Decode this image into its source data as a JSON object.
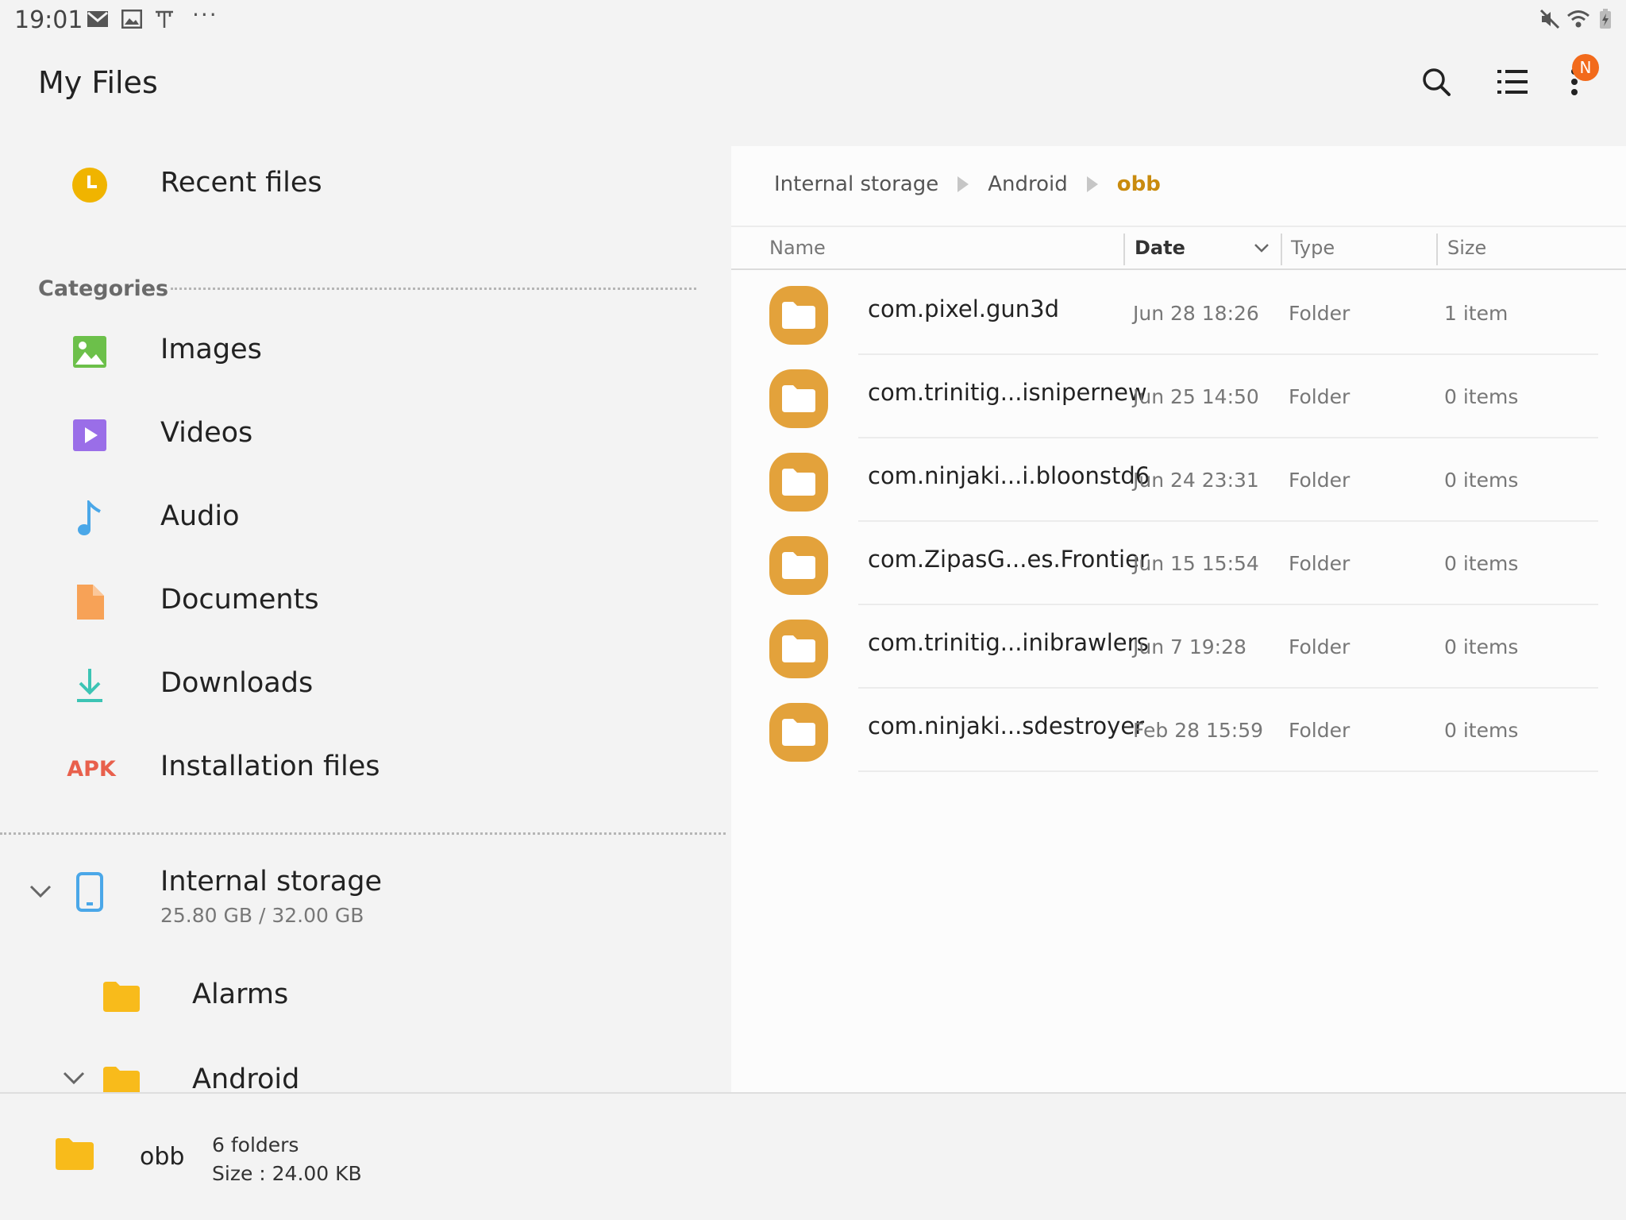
{
  "status_bar": {
    "time": "19:01",
    "left_icons": [
      "gmail-icon",
      "gallery-icon",
      "t-app-icon"
    ],
    "more": "···",
    "right_icons": [
      "mute-icon",
      "wifi-icon",
      "battery-charging-icon"
    ]
  },
  "app_bar": {
    "title": "My Files",
    "badge": "N",
    "actions": [
      "search-icon",
      "list-view-icon",
      "more-vert-icon"
    ]
  },
  "sidebar": {
    "recent": "Recent files",
    "categories_header": "Categories",
    "categories": [
      {
        "label": "Images",
        "icon": "image-icon",
        "color": "#6cc04a"
      },
      {
        "label": "Videos",
        "icon": "video-icon",
        "color": "#9a6ee8"
      },
      {
        "label": "Audio",
        "icon": "audio-note-icon",
        "color": "#4aa7e8"
      },
      {
        "label": "Documents",
        "icon": "document-icon",
        "color": "#f7a257"
      },
      {
        "label": "Downloads",
        "icon": "download-icon",
        "color": "#3cc4b4"
      },
      {
        "label": "Installation files",
        "icon": "apk-icon",
        "icon_text": "APK",
        "color": "#e8604c"
      }
    ],
    "storage": {
      "label": "Internal storage",
      "usage": "25.80 GB / 32.00 GB"
    },
    "folders": [
      {
        "label": "Alarms"
      },
      {
        "label": "Android"
      }
    ]
  },
  "breadcrumb": [
    "Internal storage",
    "Android",
    "obb"
  ],
  "columns": {
    "name": "Name",
    "date": "Date",
    "type": "Type",
    "size": "Size"
  },
  "files": [
    {
      "name": "com.pixel.gun3d",
      "date": "Jun 28 18:26",
      "type": "Folder",
      "size": "1 item"
    },
    {
      "name": "com.trinitig...isnipernew",
      "date": "Jun 25 14:50",
      "type": "Folder",
      "size": "0 items"
    },
    {
      "name": "com.ninjaki...i.bloonstd6",
      "date": "Jun 24 23:31",
      "type": "Folder",
      "size": "0 items"
    },
    {
      "name": "com.ZipasG...es.Frontier",
      "date": "Jun 15 15:54",
      "type": "Folder",
      "size": "0 items"
    },
    {
      "name": "com.trinitig...inibrawlers",
      "date": "Jun 7 19:28",
      "type": "Folder",
      "size": "0 items"
    },
    {
      "name": "com.ninjaki...sdestroyer",
      "date": "Feb 28 15:59",
      "type": "Folder",
      "size": "0 items"
    }
  ],
  "footer": {
    "name": "obb",
    "count": "6 folders",
    "size": "Size : 24.00 KB"
  },
  "colors": {
    "accent": "#c98b0e",
    "folder": "#e3a23b",
    "recent": "#f0b400",
    "badge": "#f26a1b"
  }
}
